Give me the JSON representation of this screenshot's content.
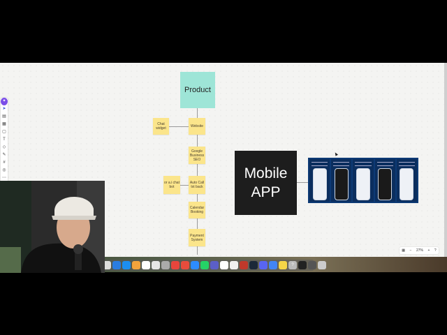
{
  "board": {
    "product": "Product",
    "mobile_app_line1": "Mobile",
    "mobile_app_line2": "APP",
    "stickies": {
      "chat_widget": "Chat widget",
      "website": "Website",
      "google_business_seo": "Google Business SEO",
      "auto_call_txt_back": "Auto Call txt back",
      "ai_chat_bot": "or a.i chat bot",
      "calendar_booking": "Calendar Booking",
      "payment_system": "Payment System"
    },
    "app_screenshots_count": 5
  },
  "toolbar": {
    "tools": [
      "ai-sparkle-icon",
      "select-cursor-icon",
      "template-icon",
      "table-icon",
      "sticky-note-icon",
      "text-icon",
      "shapes-icon",
      "pen-icon",
      "frame-icon",
      "comment-icon",
      "more-icon"
    ]
  },
  "zoom": {
    "level": "27%",
    "minus": "−",
    "plus": "+",
    "help": "?"
  },
  "dock": {
    "apps": [
      "finder",
      "launchpad",
      "safari",
      "app-store",
      "photos",
      "calendar",
      "notes",
      "mail",
      "chrome",
      "messages",
      "zoom",
      "whatsapp",
      "teams",
      "notion",
      "chatgpt",
      "calendly",
      "steam",
      "discord",
      "chrome-alt",
      "notes-yellow",
      "help",
      "activity",
      "finder-alt",
      "trash"
    ]
  },
  "colors": {
    "product_fill": "#9ee5d7",
    "sticky_fill": "#fbe58b",
    "mobile_fill": "#1d1d1d",
    "phones_bg": "#0d3a75",
    "toolbar_accent": "#7b4ee8"
  }
}
